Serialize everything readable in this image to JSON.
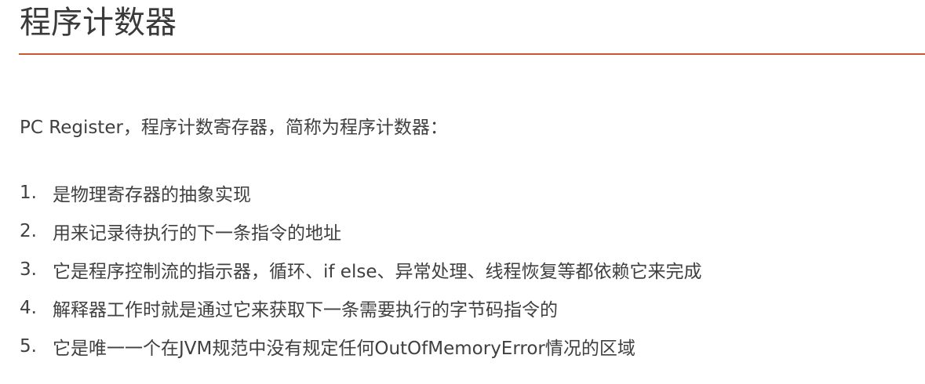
{
  "title": "程序计数器",
  "intro": "PC Register，程序计数寄存器，简称为程序计数器：",
  "points": [
    {
      "num": "1.",
      "text": "是物理寄存器的抽象实现"
    },
    {
      "num": "2.",
      "text": "用来记录待执行的下一条指令的地址"
    },
    {
      "num": "3.",
      "text": "它是程序控制流的指示器，循环、if else、异常处理、线程恢复等都依赖它来完成"
    },
    {
      "num": "4.",
      "text": "解释器工作时就是通过它来获取下一条需要执行的字节码指令的"
    },
    {
      "num": "5.",
      "text": "它是唯一一个在JVM规范中没有规定任何OutOfMemoryError情况的区域"
    }
  ],
  "colors": {
    "accent_rule": "#c9592f",
    "text": "#404040"
  }
}
